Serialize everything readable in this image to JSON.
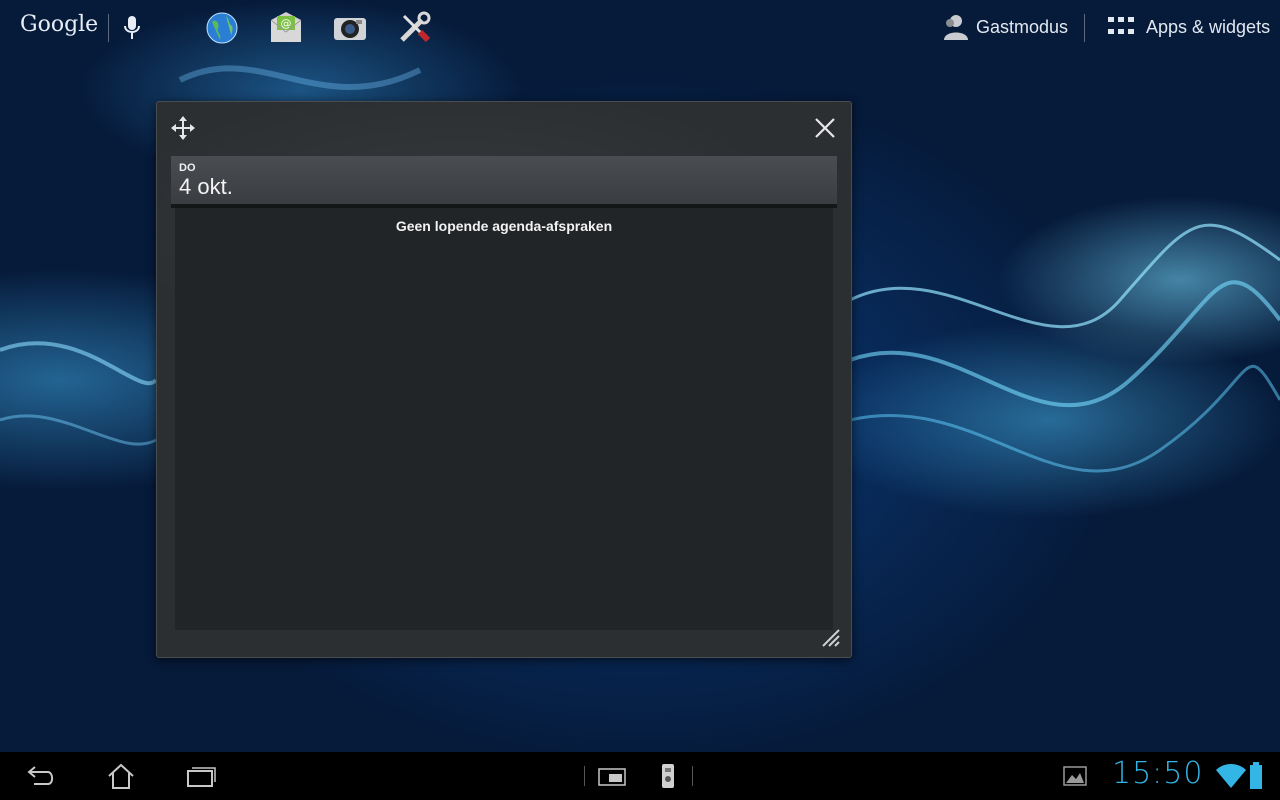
{
  "topbar": {
    "search_label": "Google",
    "apps": [
      {
        "name": "browser",
        "icon": "globe-icon"
      },
      {
        "name": "email",
        "icon": "email-icon"
      },
      {
        "name": "camera",
        "icon": "camera-icon"
      },
      {
        "name": "settings",
        "icon": "tools-icon"
      }
    ],
    "guest_label": "Gastmodus",
    "apps_label": "Apps & widgets"
  },
  "widget": {
    "day": "DO",
    "date": "4 okt.",
    "empty_message": "Geen lopende agenda-afspraken"
  },
  "statusbar": {
    "time": "15:50",
    "accent_color": "#33b5e5"
  }
}
